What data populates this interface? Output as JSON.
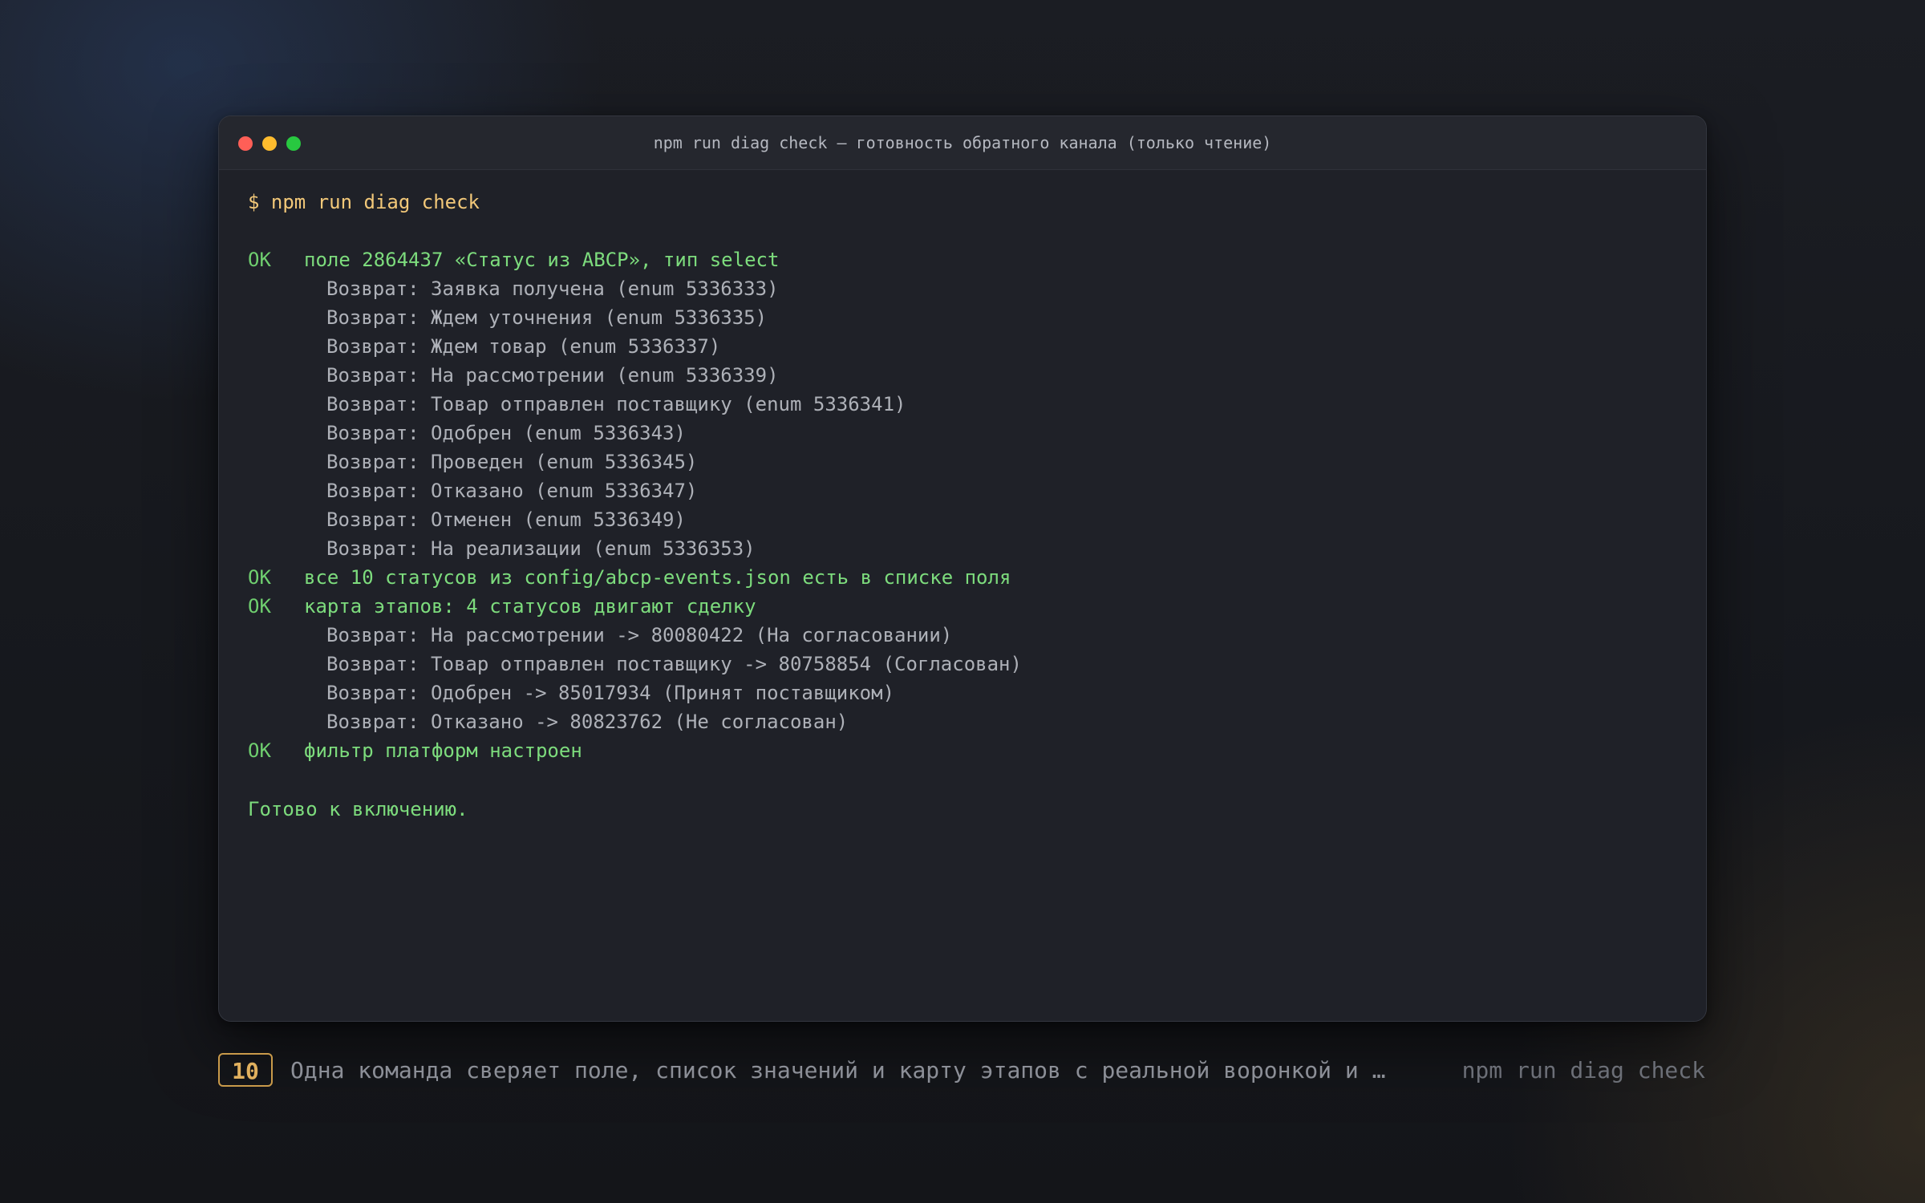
{
  "window": {
    "title": "npm run diag check — готовность обратного канала (только чтение)"
  },
  "terminal": {
    "prompt": "$ npm run diag check",
    "checks": [
      {
        "status": "OK",
        "text": "поле 2864437 «Статус из ABCP», тип select",
        "details": [
          "Возврат: Заявка получена (enum 5336333)",
          "Возврат: Ждем уточнения (enum 5336335)",
          "Возврат: Ждем товар (enum 5336337)",
          "Возврат: На рассмотрении (enum 5336339)",
          "Возврат: Товар отправлен поставщику (enum 5336341)",
          "Возврат: Одобрен (enum 5336343)",
          "Возврат: Проведен (enum 5336345)",
          "Возврат: Отказано (enum 5336347)",
          "Возврат: Отменен (enum 5336349)",
          "Возврат: На реализации (enum 5336353)"
        ]
      },
      {
        "status": "OK",
        "text": "все 10 статусов из config/abcp-events.json есть в списке поля",
        "details": []
      },
      {
        "status": "OK",
        "text": "карта этапов: 4 статусов двигают сделку",
        "details": [
          "Возврат: На рассмотрении -> 80080422 (На согласовании)",
          "Возврат: Товар отправлен поставщику -> 80758854 (Согласован)",
          "Возврат: Одобрен -> 85017934 (Принят поставщиком)",
          "Возврат: Отказано -> 80823762 (Не согласован)"
        ]
      },
      {
        "status": "OK",
        "text": "фильтр платформ настроен",
        "details": []
      }
    ],
    "result": "Готово к включению."
  },
  "footer": {
    "step_number": "10",
    "caption": "Одна команда сверяет поле, список значений и карту этапов с реальной воронкой и сообщает, готово ли к включению.",
    "command": "npm run diag check"
  },
  "colors": {
    "prompt": "#f2c879",
    "ok": "#7ddc7d",
    "detail": "#aeb1b8",
    "badge": "#e0b05e"
  }
}
